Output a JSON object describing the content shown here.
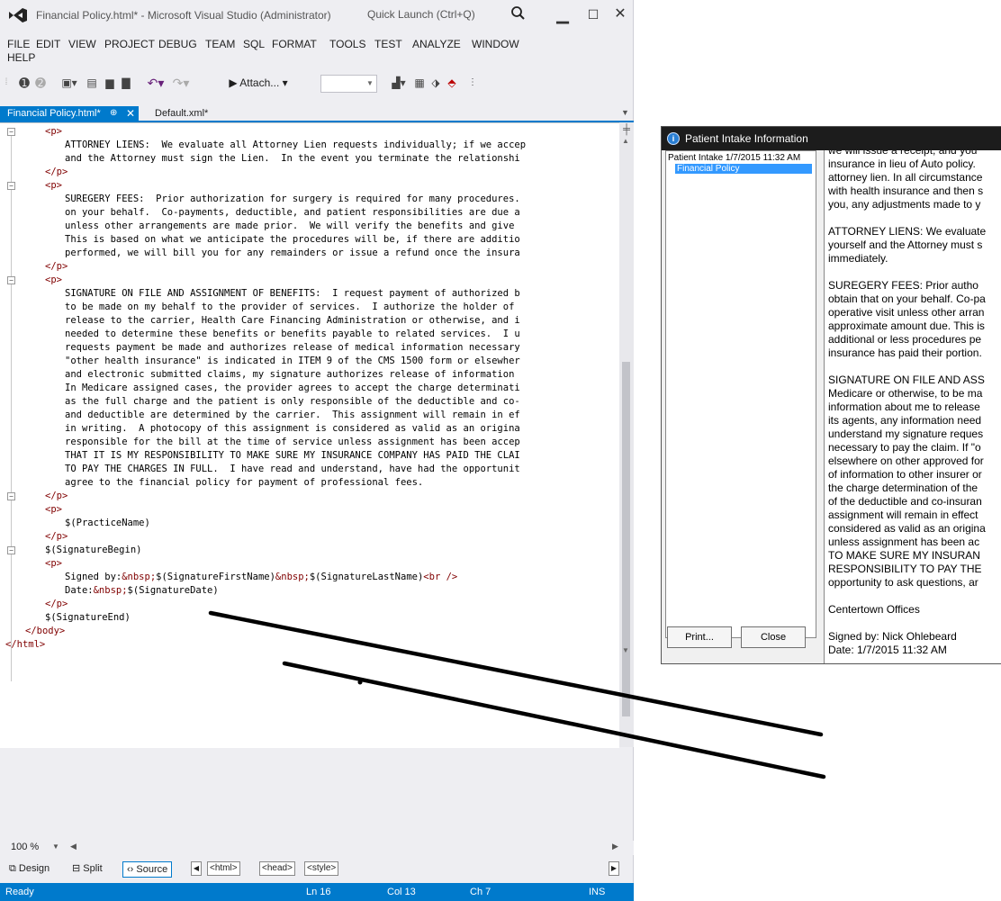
{
  "vs": {
    "title": "Financial Policy.html* - Microsoft Visual Studio (Administrator)",
    "quick_launch": "Quick Launch (Ctrl+Q)",
    "menu": [
      "FILE",
      "EDIT",
      "VIEW",
      "PROJECT",
      "DEBUG",
      "TEAM",
      "SQL",
      "FORMAT",
      "TOOLS",
      "TEST",
      "ANALYZE",
      "WINDOW",
      "HELP"
    ],
    "toolbar": {
      "attach_label": "▶ Attach... ▾"
    },
    "tabs": {
      "active": "Financial Policy.html*",
      "pin": "⊕",
      "close": "✕",
      "other": "Default.xml*"
    },
    "code_lines": [
      [
        "<p>"
      ],
      [
        "ATTORNEY LIENS:  We evaluate all Attorney Lien requests individually; if we accep"
      ],
      [
        "and the Attorney must sign the Lien.  In the event you terminate the relationshi"
      ],
      [
        "</p>"
      ],
      [
        "<p>"
      ],
      [
        "SUREGERY FEES:  Prior authorization for surgery is required for many procedures."
      ],
      [
        "on your behalf.  Co-payments, deductible, and patient responsibilities are due a"
      ],
      [
        "unless other arrangements are made prior.  We will verify the benefits and give"
      ],
      [
        "This is based on what we anticipate the procedures will be, if there are additio"
      ],
      [
        "performed, we will bill you for any remainders or issue a refund once the insura"
      ],
      [
        "</p>"
      ],
      [
        "<p>"
      ],
      [
        "SIGNATURE ON FILE AND ASSIGNMENT OF BENEFITS:  I request payment of authorized b"
      ],
      [
        "to be made on my behalf to the provider of services.  I authorize the holder of"
      ],
      [
        "release to the carrier, Health Care Financing Administration or otherwise, and i"
      ],
      [
        "needed to determine these benefits or benefits payable to related services.  I u"
      ],
      [
        "requests payment be made and authorizes release of medical information necessary"
      ],
      [
        "\"other health insurance\" is indicated in ITEM 9 of the CMS 1500 form or elsewher"
      ],
      [
        "and electronic submitted claims, my signature authorizes release of information"
      ],
      [
        "In Medicare assigned cases, the provider agrees to accept the charge determinati"
      ],
      [
        "as the full charge and the patient is only responsible of the deductible and co-"
      ],
      [
        "and deductible are determined by the carrier.  This assignment will remain in ef"
      ],
      [
        "in writing.  A photocopy of this assignment is considered as valid as an origina"
      ],
      [
        "responsible for the bill at the time of service unless assignment has been accep"
      ],
      [
        "THAT IT IS MY RESPONSIBILITY TO MAKE SURE MY INSURANCE COMPANY HAS PAID THE CLAI"
      ],
      [
        "TO PAY THE CHARGES IN FULL.  I have read and understand, have had the opportunit"
      ],
      [
        "agree to the financial policy for payment of professional fees."
      ],
      [
        "</p>"
      ],
      [
        "<p>"
      ],
      [
        "$(PracticeName)"
      ],
      [
        "</p>"
      ],
      [
        "$(SignatureBegin)"
      ],
      [
        "<p>"
      ],
      [
        "Signed by:&nbsp;$(SignatureFirstName)&nbsp;$(SignatureLastName)<br />"
      ],
      [
        "Date:&nbsp;$(SignatureDate)"
      ],
      [
        "</p>"
      ],
      [
        "$(SignatureEnd)"
      ],
      [
        "</body>"
      ],
      [
        "</html>"
      ]
    ],
    "zoom": "100 %",
    "view_bar": {
      "design": "Design",
      "split": "Split",
      "source": "Source",
      "crumbs": [
        "<html>",
        "<head>",
        "<style>"
      ]
    },
    "status": {
      "state": "Ready",
      "line": "Ln 16",
      "col": "Col 13",
      "ch": "Ch 7",
      "mode": "INS"
    }
  },
  "pi": {
    "title": "Patient Intake Information",
    "tree": {
      "root": "Patient Intake 1/7/2015 11:32 AM",
      "child": "Financial Policy"
    },
    "buttons": {
      "print": "Print...",
      "close": "Close"
    },
    "content_lines": [
      "we will issue a receipt, and you",
      "insurance in lieu of Auto policy.",
      "attorney lien. In all circumstance",
      "with health insurance and then s",
      "you, any adjustments made to y",
      "",
      "ATTORNEY LIENS: We evaluate",
      "yourself and the Attorney must s",
      "immediately.",
      "",
      "SUREGERY FEES: Prior autho",
      "obtain that on your behalf. Co-pa",
      "operative visit unless other arran",
      "approximate amount due. This is",
      "additional or less procedures pe",
      "insurance has paid their portion.",
      "",
      "SIGNATURE ON FILE AND ASS",
      "Medicare or otherwise, to be ma",
      "information about me to release",
      "its agents, any information need",
      "understand my signature reques",
      "necessary to pay the claim. If \"o",
      "elsewhere on other approved for",
      "of information to other insurer or",
      "the charge determination of the",
      "of the deductible and co-insuran",
      "assignment will remain in effect",
      "considered as valid as an origina",
      "unless assignment has been ac",
      "TO MAKE SURE MY INSURAN",
      "RESPONSIBILITY TO PAY THE",
      "opportunity to ask questions, ar",
      "",
      "Centertown Offices",
      "",
      "Signed by: Nick Ohlebeard",
      "Date: 1/7/2015 11:32 AM"
    ]
  },
  "colors": {
    "accent": "#007acc",
    "tag": "#800000",
    "title_bar_dark": "#1c1c1c",
    "selection": "#3399ff"
  }
}
